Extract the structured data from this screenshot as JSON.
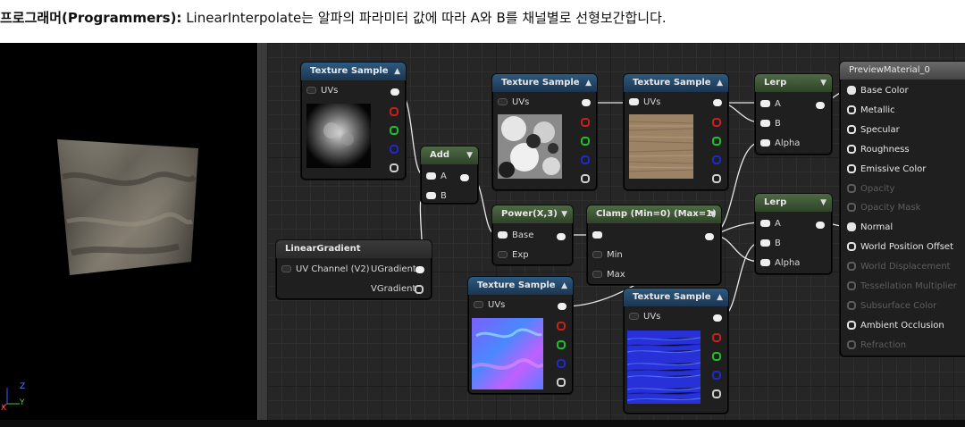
{
  "caption": {
    "bold": "프로그래머(Programmers):",
    "text": " LinearInterpolate는 알파의 파라미터 값에 따라 A와 B를 채널별로 선형보간합니다."
  },
  "viewport": {
    "axis_z": "Z",
    "axis_y": "Y",
    "axis_x": "X"
  },
  "nodes": {
    "tex1": {
      "title": "Texture Sample",
      "uvs": "UVs"
    },
    "tex2": {
      "title": "Texture Sample",
      "uvs": "UVs"
    },
    "tex3": {
      "title": "Texture Sample",
      "uvs": "UVs"
    },
    "tex4": {
      "title": "Texture Sample",
      "uvs": "UVs"
    },
    "tex5": {
      "title": "Texture Sample",
      "uvs": "UVs"
    },
    "add": {
      "title": "Add",
      "a": "A",
      "b": "B"
    },
    "power": {
      "title": "Power(X,3)",
      "base": "Base",
      "exp": "Exp"
    },
    "clamp": {
      "title": "Clamp (Min=0) (Max=1)",
      "min": "Min",
      "max": "Max"
    },
    "lerp1": {
      "title": "Lerp",
      "a": "A",
      "b": "B",
      "alpha": "Alpha"
    },
    "lerp2": {
      "title": "Lerp",
      "a": "A",
      "b": "B",
      "alpha": "Alpha"
    },
    "gradient": {
      "title": "LinearGradient",
      "uv_channel": "UV Channel (V2)",
      "ugradient": "UGradient",
      "vgradient": "VGradient"
    },
    "material": {
      "title": "PreviewMaterial_0",
      "pins": [
        {
          "label": "Base Color",
          "active": true
        },
        {
          "label": "Metallic",
          "active": true
        },
        {
          "label": "Specular",
          "active": true
        },
        {
          "label": "Roughness",
          "active": true
        },
        {
          "label": "Emissive Color",
          "active": true
        },
        {
          "label": "Opacity",
          "active": false
        },
        {
          "label": "Opacity Mask",
          "active": false
        },
        {
          "label": "Normal",
          "active": true
        },
        {
          "label": "World Position Offset",
          "active": true
        },
        {
          "label": "World Displacement",
          "active": false
        },
        {
          "label": "Tessellation Multiplier",
          "active": false
        },
        {
          "label": "Subsurface Color",
          "active": false
        },
        {
          "label": "Ambient Occlusion",
          "active": true
        },
        {
          "label": "Refraction",
          "active": false
        }
      ]
    }
  },
  "colors": {
    "texture_header": "#2c5a80",
    "math_header": "#4e6a45",
    "pin_red": "#c8201c",
    "pin_green": "#20c02a",
    "pin_blue": "#1c2ad0",
    "pin_white": "#f0f0f0"
  }
}
